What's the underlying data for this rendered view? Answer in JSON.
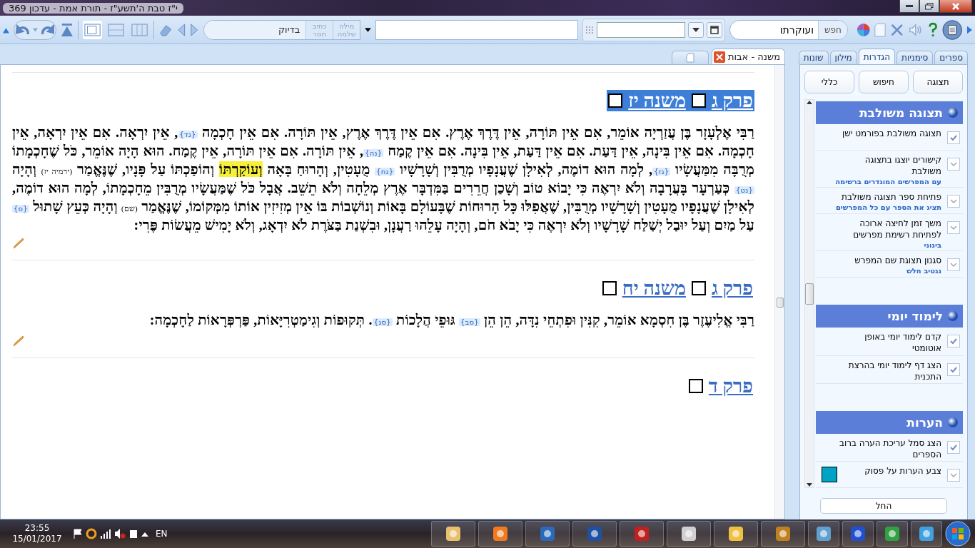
{
  "window": {
    "title": "י\"ז טבת ה'תשע\"ז  -  תורת אמת - עדכון 369"
  },
  "toolbar": {
    "layouts": [
      {
        "selected": true
      },
      {
        "selected": false
      },
      {
        "selected": false
      }
    ],
    "search_mode": {
      "value": "בדיוק"
    },
    "search_options": [
      {
        "label": "מילה שלמה",
        "on": false
      },
      {
        "label": "כתיב חסר",
        "on": false
      }
    ],
    "search": {
      "value": "ועוקרתו",
      "button": "חפש"
    }
  },
  "doc_tabs": [
    {
      "label": "משנה - אבות",
      "selected": true
    }
  ],
  "mishnayot": [
    {
      "heading": {
        "chapter": "פרק ג",
        "mishna": "משנה יז",
        "selected": true
      },
      "segments": [
        {
          "kind": "text",
          "text": "רַבִּי אֶלְעָזָר בֶּן עֲזַרְיָה אוֹמֵר, אִם אֵין תּוֹרָה, אֵין דֶּרֶךְ אֶרֶץ. אִם אֵין דֶּרֶךְ אֶרֶץ, אֵין תּוֹרָה. אִם אֵין חָכְמָה "
        },
        {
          "kind": "note",
          "text": "{נד}"
        },
        {
          "kind": "text",
          "text": ", אֵין יִרְאָה. אִם אֵין יִרְאָה, אֵין חָכְמָה. אִם אֵין בִּינָה, אֵין דַּעַת. אִם אֵין דַּעַת, אֵין בִּינָה. אִם אֵין קֶמַח "
        },
        {
          "kind": "note",
          "text": "{נה}"
        },
        {
          "kind": "text",
          "text": ", אֵין תּוֹרָה. אִם אֵין תּוֹרָה, אֵין קֶמַח. הוּא הָיָה אוֹמֵר, כֹּל שֶׁחָכְמָתוֹ מְרֻבָּה מִמַּעֲשָׂיו "
        },
        {
          "kind": "note",
          "text": "{נז}"
        },
        {
          "kind": "text",
          "text": ", לְמָה הוּא דוֹמֶה, לְאִילָן שֶׁעֲנָפָיו מְרֻבִּין וְשָׁרָשָׁיו "
        },
        {
          "kind": "note",
          "text": "{נח}"
        },
        {
          "kind": "text",
          "text": " מֻעָטִין, וְהָרוּחַ בָּאָה "
        },
        {
          "kind": "mark",
          "text": "וְעוֹקַרְתּוֹ"
        },
        {
          "kind": "text",
          "text": " וְהוֹפַכְתּוֹ עַל פָּנָיו, שֶׁנֶּאֱמַר "
        },
        {
          "kind": "source",
          "text": "(ירמיה יז)"
        },
        {
          "kind": "text",
          "text": " וְהָיָה "
        },
        {
          "kind": "note",
          "text": "{נט}"
        },
        {
          "kind": "text",
          "text": " כְּעַרְעָר בָּעֲרָבָה וְלֹא יִרְאֶה כִּי יָבוֹא טוֹב וְשָׁכַן חֲרֵרִים בַּמִּדְבָּר אֶרֶץ מְלֵחָה וְלֹא תֵשֵׁב. אֲבָל כֹּל שֶׁמַּעֲשָׂיו מְרֻבִּין מֵחָכְמָתוֹ, לְמָה הוּא דוֹמֶה, לְאִילָן שֶׁעֲנָפָיו מֻעָטִין וְשָׁרָשָׁיו מְרֻבִּין, שֶׁאֲפִלּוּ כָּל הָרוּחוֹת שֶׁבָּעוֹלָם בָּאוֹת וְנוֹשְׁבוֹת בּוֹ אֵין מְזִיזִין אוֹתוֹ מִמְּקוֹמוֹ, שֶׁנֶּאֱמַר "
        },
        {
          "kind": "source",
          "text": "(שם)"
        },
        {
          "kind": "text",
          "text": " וְהָיָה כְּעֵץ שָׁתוּל "
        },
        {
          "kind": "note",
          "text": "{ס}"
        },
        {
          "kind": "text",
          "text": " עַל מַיִם וְעַל יוּבַל יְשַׁלַּח שָׁרָשָׁיו וְלֹא יִרְאֶה כִּי יָבֹא חֹם, וְהָיָה עָלֵהוּ רַעֲנָן, וּבִשְׁנַת בַּצֹּרֶת לֹא יִדְאָג, וְלֹא יָמִישׁ מֵעֲשׂוֹת פֶּרִי:"
        }
      ]
    },
    {
      "heading": {
        "chapter": "פרק ג",
        "mishna": "משנה יח",
        "selected": false
      },
      "segments": [
        {
          "kind": "text",
          "text": "רַבִּי אֱלִיעֶזֶר בֶּן חִסְמָא אוֹמֵר, קִנִּין וּפִתְחֵי נִדָּה, הֵן הֵן "
        },
        {
          "kind": "note",
          "text": "{סב}"
        },
        {
          "kind": "text",
          "text": " גּוּפֵי הֲלָכוֹת "
        },
        {
          "kind": "note",
          "text": "{סג}"
        },
        {
          "kind": "text",
          "text": ". תְּקוּפוֹת וְגִימַטְרִיָּאוֹת, פַּרְפְּרָאוֹת לַחָכְמָה:"
        }
      ]
    }
  ],
  "next_chapter": "פרק ד",
  "panel_tabs": [
    {
      "label": "ספרים",
      "selected": false
    },
    {
      "label": "סימניות",
      "selected": false
    },
    {
      "label": "הגדרות",
      "selected": true
    },
    {
      "label": "מילון",
      "selected": false
    },
    {
      "label": "שונות",
      "selected": false
    }
  ],
  "panel_buttons": [
    "תצוגה",
    "חיפוש",
    "כללי"
  ],
  "sections": [
    {
      "title": "תצוגה משולבת",
      "items": [
        {
          "kind": "check",
          "label": "תצוגה משולבת בפורמט ישן",
          "checked": true
        },
        {
          "kind": "select",
          "label": "קישורים יוצגו בתצוגה משולבת",
          "value": "עם המפרשים המוגדרים ברשימה"
        },
        {
          "kind": "select",
          "label": "פתיחת ספר תצוגה משולבת",
          "value": "תציג את הספר עם כל המפרשים"
        },
        {
          "kind": "select",
          "label": "משך זמן לחיצה ארוכה לפתיחת רשימת מפרשים",
          "value": "בינוני"
        },
        {
          "kind": "select",
          "label": "סגנון תצוגת שם המפרש",
          "value": "נגטיב חלש"
        }
      ]
    },
    {
      "title": "לימוד יומי",
      "items": [
        {
          "kind": "check",
          "label": "קדם לימוד יומי באופן אוטומטי",
          "checked": true
        },
        {
          "kind": "check",
          "label": "הצג דף לימוד יומי בהרצת התכנית",
          "checked": true
        }
      ]
    },
    {
      "title": "הערות",
      "items": [
        {
          "kind": "check",
          "label": "הצג סמל עריכת הערה ברוב הספרים",
          "checked": true
        },
        {
          "kind": "color",
          "label": "צבע הערות על פסוק",
          "color": "#00a3c4"
        }
      ]
    }
  ],
  "apply_button": "החל",
  "taskbar": {
    "time": "23:55",
    "date": "15/01/2017",
    "language": "EN"
  }
}
